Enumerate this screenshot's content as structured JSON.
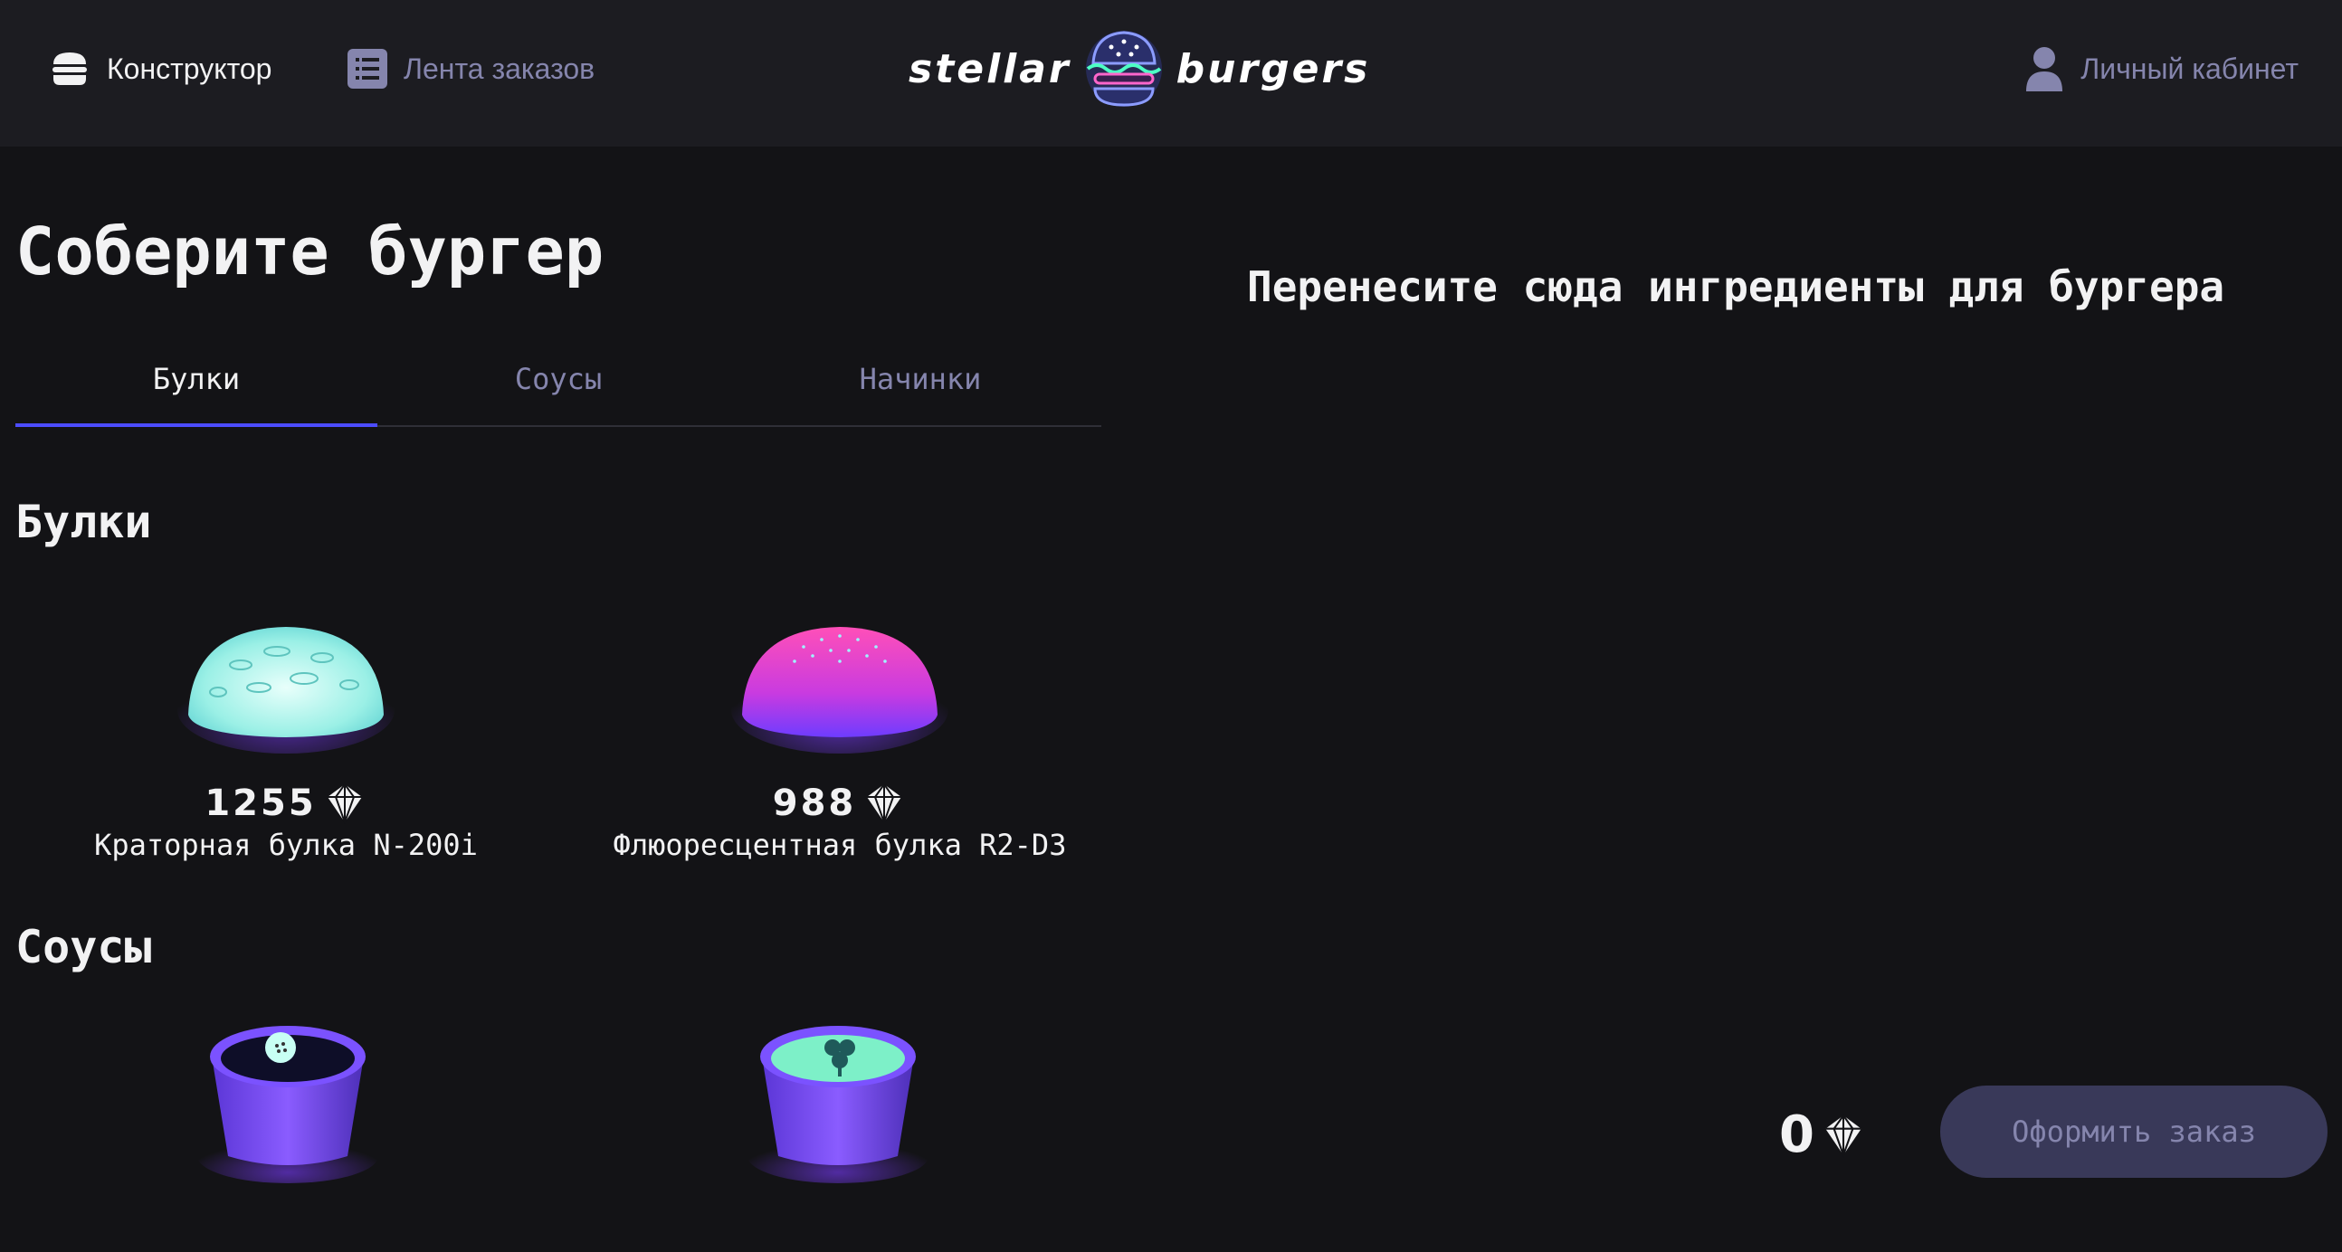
{
  "header": {
    "nav": {
      "constructor_label": "Конструктор",
      "feed_label": "Лента заказов",
      "profile_label": "Личный кабинет"
    },
    "logo": {
      "left_word": "stellar",
      "right_word": "burgers"
    }
  },
  "constructor": {
    "title": "Соберите бургер",
    "tabs": [
      {
        "label": "Булки",
        "active": true
      },
      {
        "label": "Соусы",
        "active": false
      },
      {
        "label": "Начинки",
        "active": false
      }
    ],
    "sections": {
      "buns": {
        "title": "Булки",
        "items": [
          {
            "price": "1255",
            "name": "Краторная булка N-200i",
            "image": "crater-bun-image"
          },
          {
            "price": "988",
            "name": "Флюоресцентная булка R2-D3",
            "image": "fluorescent-bun-image"
          }
        ]
      },
      "sauces": {
        "title": "Соусы",
        "items": [
          {
            "image": "spicy-sauce-image"
          },
          {
            "image": "space-sauce-image"
          }
        ]
      }
    }
  },
  "order": {
    "drop_hint": "Перенесите сюда ингредиенты для бургера",
    "total": "0",
    "submit_label": "Оформить заказ"
  },
  "colors": {
    "background": "#131316",
    "header": "#1c1c21",
    "accent": "#4c4cff",
    "inactive": "#8585ad",
    "button_disabled": "#393959"
  },
  "icons": {
    "constructor": "burger-icon",
    "feed": "list-icon",
    "profile": "profile-icon",
    "currency": "currency-icon"
  }
}
